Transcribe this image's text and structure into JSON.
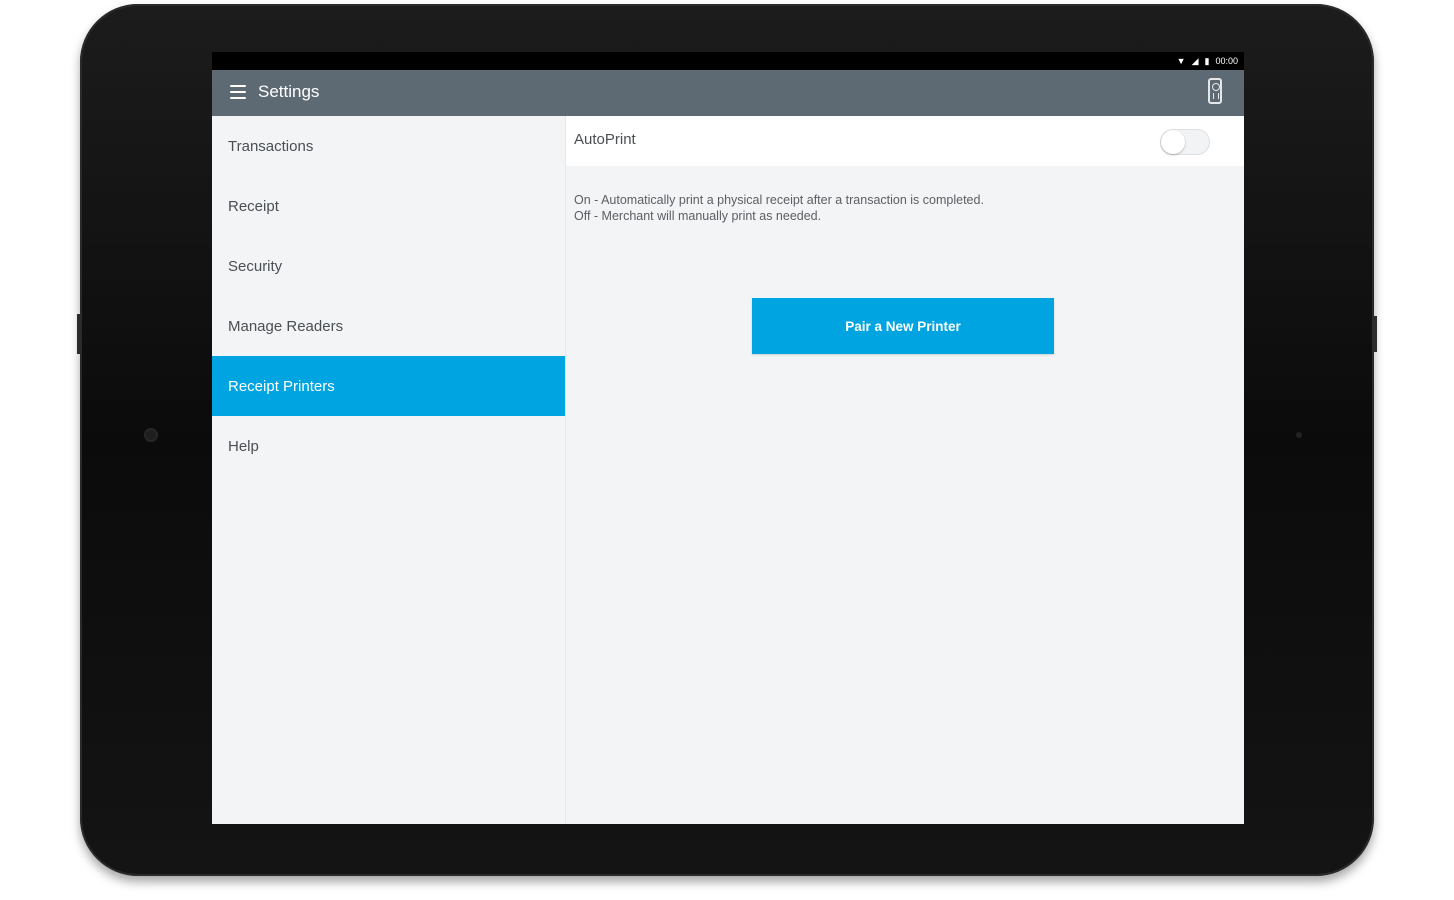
{
  "status_bar": {
    "wifi_icon": "wifi-icon",
    "signal_icon": "signal-icon",
    "battery_icon": "battery-icon",
    "time": "00:00"
  },
  "app_bar": {
    "menu_icon": "hamburger-menu-icon",
    "title": "Settings",
    "right_icon": "card-reader-icon",
    "background": "#5e6a73"
  },
  "sidebar": {
    "items": [
      {
        "label": "Transactions",
        "active": false
      },
      {
        "label": "Receipt",
        "active": false
      },
      {
        "label": "Security",
        "active": false
      },
      {
        "label": "Manage Readers",
        "active": false
      },
      {
        "label": "Receipt Printers",
        "active": true
      },
      {
        "label": "Help",
        "active": false
      }
    ],
    "active_color": "#00a4e0"
  },
  "content": {
    "autoprint": {
      "label": "AutoPrint",
      "toggle_state": "off"
    },
    "description": {
      "on_line": "On - Automatically print a physical receipt after a transaction is completed.",
      "off_line": "Off -  Merchant will manually print as needed."
    },
    "pair_button_label": "Pair a New Printer",
    "accent_color": "#00a4e0"
  }
}
